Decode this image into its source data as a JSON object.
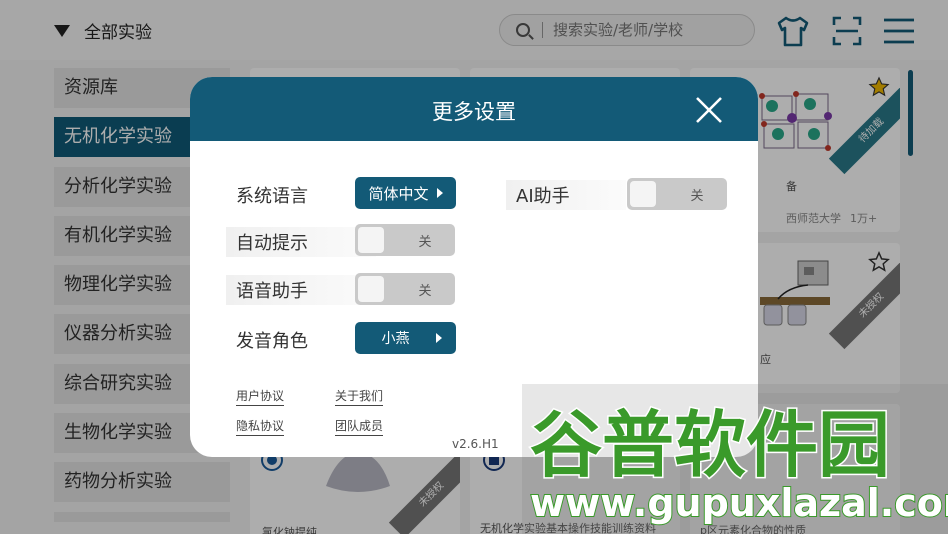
{
  "header": {
    "filter_label": "全部实验",
    "search_placeholder": "搜索实验/老师/学校",
    "icons": [
      "shirt-icon",
      "scan-icon",
      "menu-icon"
    ]
  },
  "sidebar": {
    "items": [
      {
        "label": "资源库",
        "active": false
      },
      {
        "label": "无机化学实验",
        "active": true
      },
      {
        "label": "分析化学实验",
        "active": false
      },
      {
        "label": "有机化学实验",
        "active": false
      },
      {
        "label": "物理化学实验",
        "active": false
      },
      {
        "label": "仪器分析实验",
        "active": false
      },
      {
        "label": "综合研究实验",
        "active": false
      },
      {
        "label": "生物化学实验",
        "active": false
      },
      {
        "label": "药物分析实验",
        "active": false
      }
    ]
  },
  "cards": {
    "card1": {
      "ribbon": "待加载",
      "title_fragment": "备",
      "school_fragment": "西师范大学",
      "count": "1万+"
    },
    "card2": {
      "ribbon": "未授权",
      "title_fragment": "应"
    },
    "card3": {
      "ribbon": "未授权",
      "title_fragment": "氯化钠提纯"
    },
    "card4": {
      "title_fragment": "无机化学实验基本操作技能训练资料"
    },
    "card5": {
      "title_fragment": "p区元素化合物的性质"
    }
  },
  "modal": {
    "title": "更多设置",
    "language_label": "系统语言",
    "language_value": "简体中文",
    "ai_label": "AI助手",
    "ai_state": "关",
    "auto_hint_label": "自动提示",
    "auto_hint_state": "关",
    "voice_label": "语音助手",
    "voice_state": "关",
    "role_label": "发音角色",
    "role_value": "小燕",
    "links": {
      "user_agreement": "用户协议",
      "about_us": "关于我们",
      "privacy": "隐私协议",
      "team": "团队成员"
    },
    "version": "v2.6.H1"
  },
  "watermark": {
    "line1": "谷普软件园",
    "line2": "www.gupuxlazal.com"
  },
  "colors": {
    "primary": "#135a77",
    "sidebar_active": "#0f5a78",
    "toggle_off": "#c9c9c9",
    "watermark_green": "#3a9a2a"
  }
}
